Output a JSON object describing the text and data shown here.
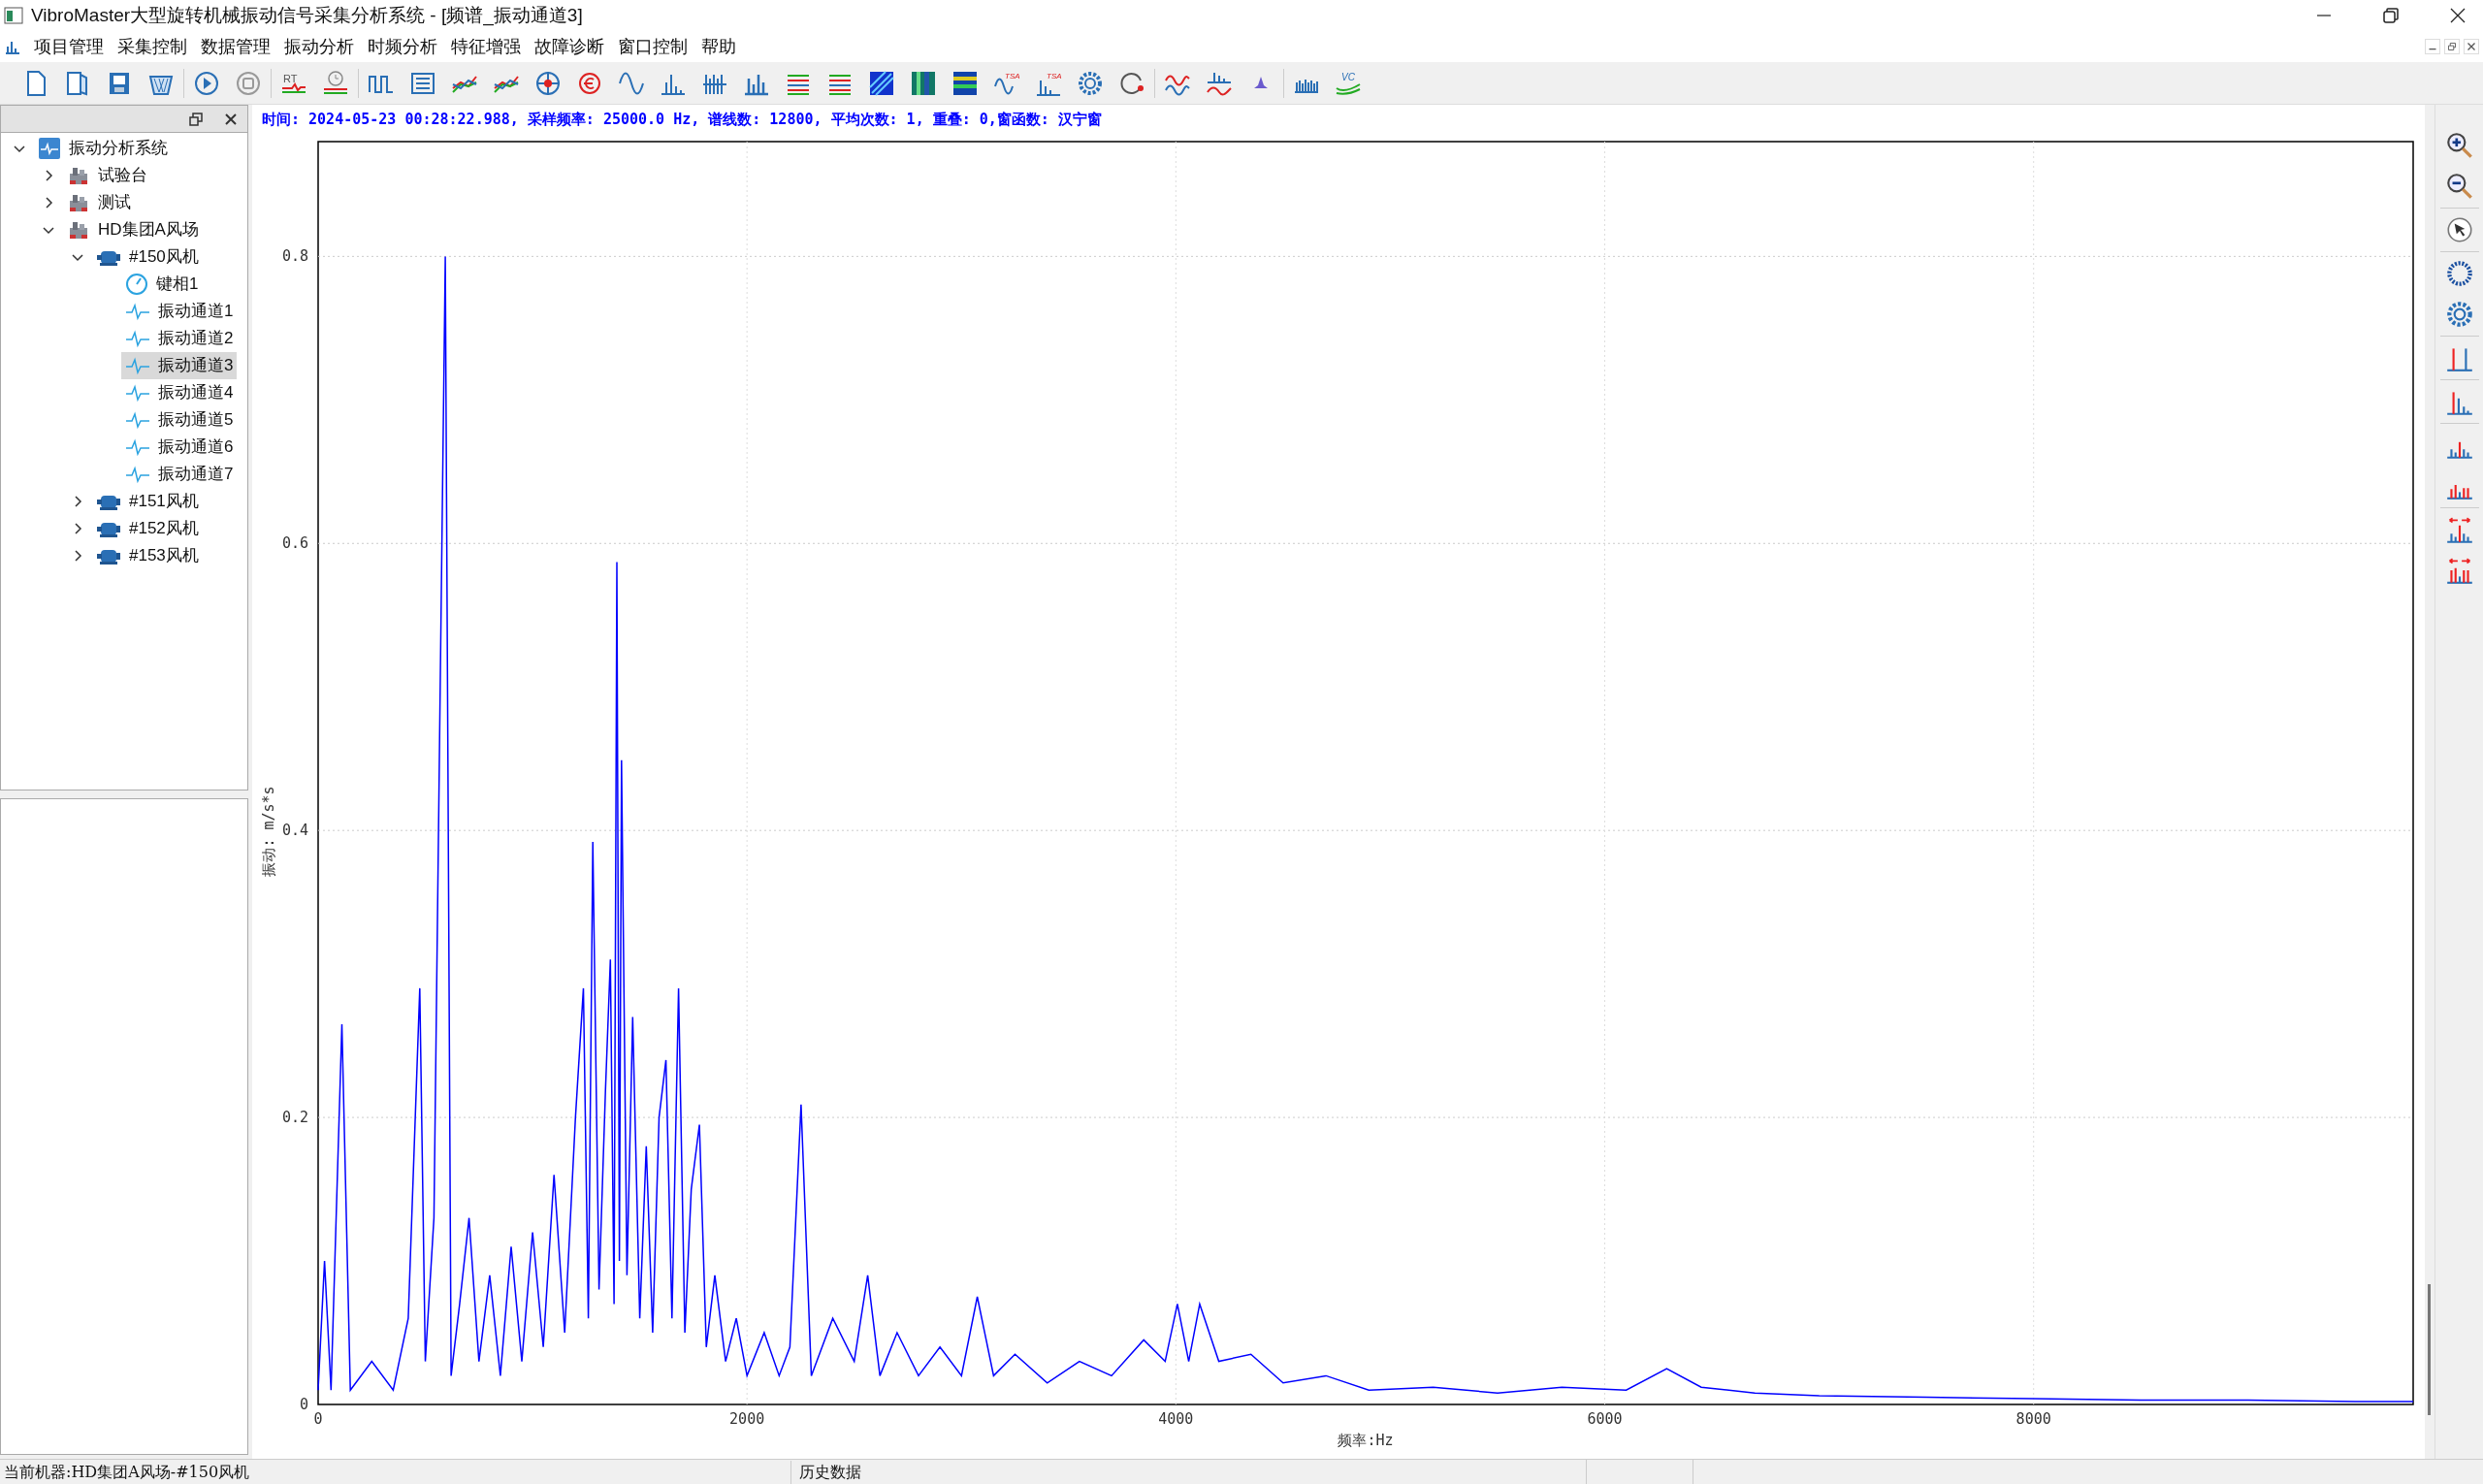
{
  "window": {
    "title": "VibroMaster大型旋转机械振动信号采集分析系统 - [频谱_振动通道3]"
  },
  "menu": [
    "项目管理",
    "采集控制",
    "数据管理",
    "振动分析",
    "时频分析",
    "特征增强",
    "故障诊断",
    "窗口控制",
    "帮助"
  ],
  "toolbar": {
    "labels": [
      "RT",
      "TSA",
      "TSA",
      "VC"
    ]
  },
  "tree": [
    {
      "label": "振动分析系统",
      "kind": "root",
      "expanded": true,
      "selected": false,
      "children": [
        {
          "label": "试验台",
          "kind": "site",
          "expanded": false,
          "selected": false
        },
        {
          "label": "测试",
          "kind": "site",
          "expanded": false,
          "selected": false
        },
        {
          "label": "HD集团A风场",
          "kind": "site",
          "expanded": true,
          "selected": false,
          "children": [
            {
              "label": "#150风机",
              "kind": "machine",
              "expanded": true,
              "selected": false,
              "children": [
                {
                  "label": "键相1",
                  "kind": "keyphase",
                  "selected": false
                },
                {
                  "label": "振动通道1",
                  "kind": "channel",
                  "selected": false
                },
                {
                  "label": "振动通道2",
                  "kind": "channel",
                  "selected": false
                },
                {
                  "label": "振动通道3",
                  "kind": "channel",
                  "selected": true
                },
                {
                  "label": "振动通道4",
                  "kind": "channel",
                  "selected": false
                },
                {
                  "label": "振动通道5",
                  "kind": "channel",
                  "selected": false
                },
                {
                  "label": "振动通道6",
                  "kind": "channel",
                  "selected": false
                },
                {
                  "label": "振动通道7",
                  "kind": "channel",
                  "selected": false
                }
              ]
            },
            {
              "label": "#151风机",
              "kind": "machine",
              "expanded": false,
              "selected": false
            },
            {
              "label": "#152风机",
              "kind": "machine",
              "expanded": false,
              "selected": false
            },
            {
              "label": "#153风机",
              "kind": "machine",
              "expanded": false,
              "selected": false
            }
          ]
        }
      ]
    }
  ],
  "chart": {
    "info": "时间: 2024-05-23 00:28:22.988, 采样频率: 25000.0 Hz, 谱线数: 12800, 平均次数: 1, 重叠: 0,窗函数: 汉宁窗",
    "chart_data": {
      "type": "line",
      "xlabel": "频率:Hz",
      "ylabel": "振动: m/s*s",
      "xlim": [
        0,
        9770
      ],
      "ylim": [
        0,
        0.88
      ],
      "xticks": [
        0,
        2000,
        4000,
        6000,
        8000
      ],
      "yticks": [
        0,
        {
          "value": 0.2,
          "label": "0.2"
        },
        {
          "value": 0.4,
          "label": "0.4"
        },
        {
          "value": 0.6,
          "label": "0.6"
        },
        {
          "value": 0.8,
          "label": "0.8"
        }
      ],
      "x": [
        0,
        30,
        60,
        111,
        150,
        250,
        350,
        420,
        474,
        500,
        540,
        593,
        620,
        660,
        704,
        750,
        800,
        850,
        900,
        950,
        1000,
        1050,
        1100,
        1150,
        1200,
        1237,
        1260,
        1281,
        1310,
        1340,
        1363,
        1380,
        1393,
        1405,
        1415,
        1440,
        1467,
        1500,
        1530,
        1560,
        1590,
        1622,
        1650,
        1681,
        1710,
        1740,
        1778,
        1810,
        1850,
        1900,
        1950,
        2000,
        2080,
        2150,
        2200,
        2252,
        2300,
        2400,
        2500,
        2563,
        2620,
        2700,
        2800,
        2900,
        3000,
        3074,
        3150,
        3250,
        3400,
        3550,
        3700,
        3850,
        3950,
        4007,
        4060,
        4111,
        4200,
        4350,
        4500,
        4700,
        4900,
        5200,
        5500,
        5800,
        6100,
        6289,
        6450,
        6700,
        7000,
        7500,
        8000,
        8500,
        9000,
        9500,
        9770
      ],
      "grid": true,
      "series": [
        {
          "color": "#0000ff",
          "values": [
            0.01,
            0.1,
            0.01,
            0.265,
            0.01,
            0.03,
            0.01,
            0.06,
            0.29,
            0.03,
            0.13,
            0.8,
            0.02,
            0.07,
            0.13,
            0.03,
            0.09,
            0.02,
            0.11,
            0.03,
            0.12,
            0.04,
            0.16,
            0.05,
            0.2,
            0.29,
            0.06,
            0.392,
            0.08,
            0.22,
            0.31,
            0.07,
            0.587,
            0.1,
            0.449,
            0.09,
            0.27,
            0.06,
            0.18,
            0.05,
            0.2,
            0.24,
            0.06,
            0.29,
            0.05,
            0.15,
            0.195,
            0.04,
            0.09,
            0.03,
            0.06,
            0.02,
            0.05,
            0.02,
            0.04,
            0.209,
            0.02,
            0.06,
            0.03,
            0.09,
            0.02,
            0.05,
            0.02,
            0.04,
            0.02,
            0.075,
            0.02,
            0.035,
            0.015,
            0.03,
            0.02,
            0.045,
            0.03,
            0.07,
            0.03,
            0.07,
            0.03,
            0.035,
            0.015,
            0.02,
            0.01,
            0.012,
            0.008,
            0.012,
            0.01,
            0.025,
            0.012,
            0.008,
            0.006,
            0.005,
            0.004,
            0.003,
            0.003,
            0.002,
            0.002
          ]
        }
      ]
    }
  },
  "status_bar": [
    "当前机器:HD集团A风场-#150风机",
    "历史数据"
  ]
}
